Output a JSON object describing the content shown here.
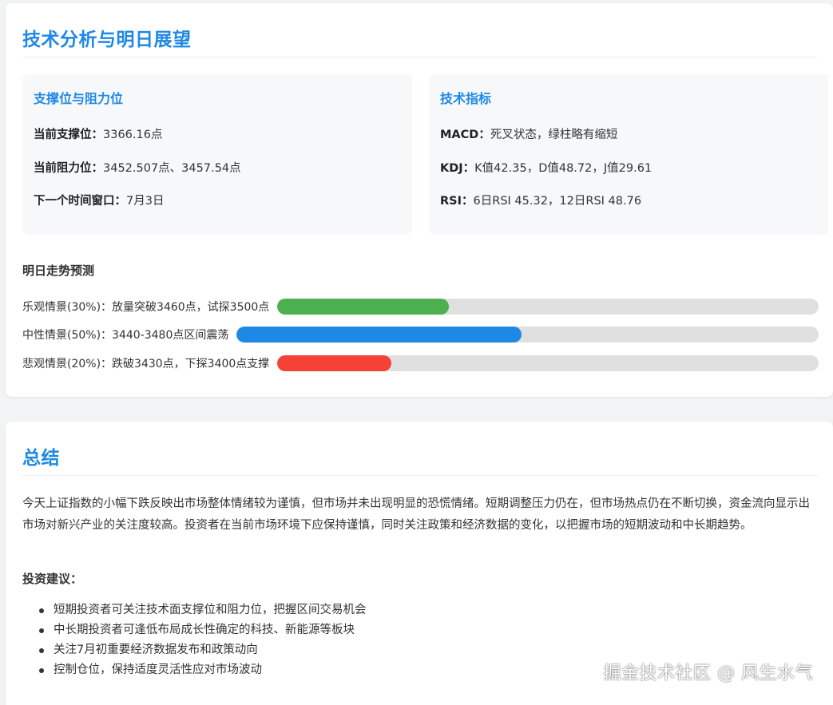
{
  "colors": {
    "accent": "#1e88e5",
    "optimistic": "#4caf50",
    "neutral": "#1e88e5",
    "pessimistic": "#f44336",
    "track": "#e0e0e0"
  },
  "tech_section": {
    "title": "技术分析与明日展望",
    "support_panel": {
      "title": "支撑位与阻力位",
      "rows": [
        {
          "label": "当前支撑位：",
          "value": "3366.16点"
        },
        {
          "label": "当前阻力位：",
          "value": "3452.507点、3457.54点"
        },
        {
          "label": "下一个时间窗口：",
          "value": "7月3日"
        }
      ]
    },
    "indicators_panel": {
      "title": "技术指标",
      "rows": [
        {
          "label": "MACD：",
          "value": "死叉状态，绿柱略有缩短"
        },
        {
          "label": "KDJ：",
          "value": "K值42.35，D值48.72，J值29.61"
        },
        {
          "label": "RSI：",
          "value": "6日RSI 45.32，12日RSI 48.76"
        }
      ]
    },
    "forecast": {
      "title": "明日走势预测",
      "scenarios": [
        {
          "label": "乐观情景(30%)：放量突破3460点，试探3500点",
          "percent": 30
        },
        {
          "label": "中性情景(50%)：3440-3480点区间震荡",
          "percent": 50
        },
        {
          "label": "悲观情景(20%)：跌破3430点，下探3400点支撑",
          "percent": 20
        }
      ]
    }
  },
  "summary_section": {
    "title": "总结",
    "paragraph": "今天上证指数的小幅下跌反映出市场整体情绪较为谨慎，但市场并未出现明显的恐慌情绪。短期调整压力仍在，但市场热点仍在不断切换，资金流向显示出市场对新兴产业的关注度较高。投资者在当前市场环境下应保持谨慎，同时关注政策和经济数据的变化，以把握市场的短期波动和中长期趋势。",
    "advice_title": "投资建议：",
    "advice_items": [
      "短期投资者可关注技术面支撑位和阻力位，把握区间交易机会",
      "中长期投资者可逢低布局成长性确定的科技、新能源等板块",
      "关注7月初重要经济数据发布和政策动向",
      "控制仓位，保持适度灵活性应对市场波动"
    ]
  },
  "watermark": "掘金技术社区 @ 风生水气"
}
